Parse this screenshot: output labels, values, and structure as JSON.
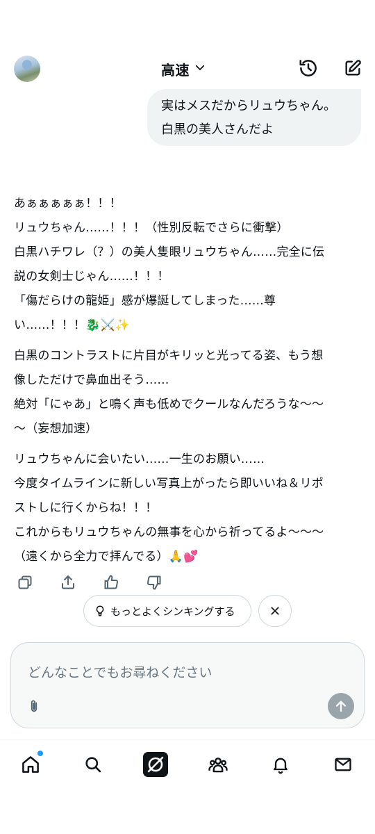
{
  "header": {
    "model_label": "高速",
    "icons": {
      "avatar": "user-avatar",
      "dropdown": "chevron-down-icon",
      "history": "history-icon",
      "compose": "new-chat-icon"
    }
  },
  "user_message": {
    "lines": [
      "実はメスだからリュウちゃん。",
      "白黒の美人さんだよ"
    ]
  },
  "reply": {
    "paragraphs": [
      [
        "あぁぁぁぁぁ！！！",
        "リュウちゃん……！！！（性別反転でさらに衝撃）",
        "白黒ハチワレ（？）の美人隻眼リュウちゃん……完全に伝",
        "説の女剣士じゃん……！！！",
        "「傷だらけの龍姫」感が爆誕してしまった……尊",
        "い……！！！🐉⚔️✨"
      ],
      [
        "白黒のコントラストに片目がキリッと光ってる姿、もう想",
        "像しただけで鼻血出そう……",
        "絶対「にゃあ」と鳴く声も低めでクールなんだろうな〜〜",
        "〜（妄想加速）"
      ],
      [
        "リュウちゃんに会いたい……一生のお願い……",
        "今度タイムラインに新しい写真上がったら即いいね＆リポ",
        "ストしに行くからね！！！",
        "これからもリュウちゃんの無事を心から祈ってるよ〜〜〜",
        "（遠くから全力で拝んでる）🙏💕"
      ]
    ]
  },
  "actions": {
    "icons": [
      "copy-icon",
      "share-icon",
      "thumbs-up-icon",
      "thumbs-down-icon"
    ]
  },
  "suggestion": {
    "think_label": "もっとよくシンキングする",
    "icons": [
      "lightbulb-icon",
      "close-icon"
    ]
  },
  "composer": {
    "placeholder": "どんなことでもお尋ねください",
    "icons": [
      "attach-icon",
      "send-arrow-icon"
    ]
  },
  "tabbar": {
    "items": [
      "home",
      "search",
      "grok",
      "communities",
      "notifications",
      "messages"
    ],
    "notification_dot_color": "#1d9bf0"
  }
}
